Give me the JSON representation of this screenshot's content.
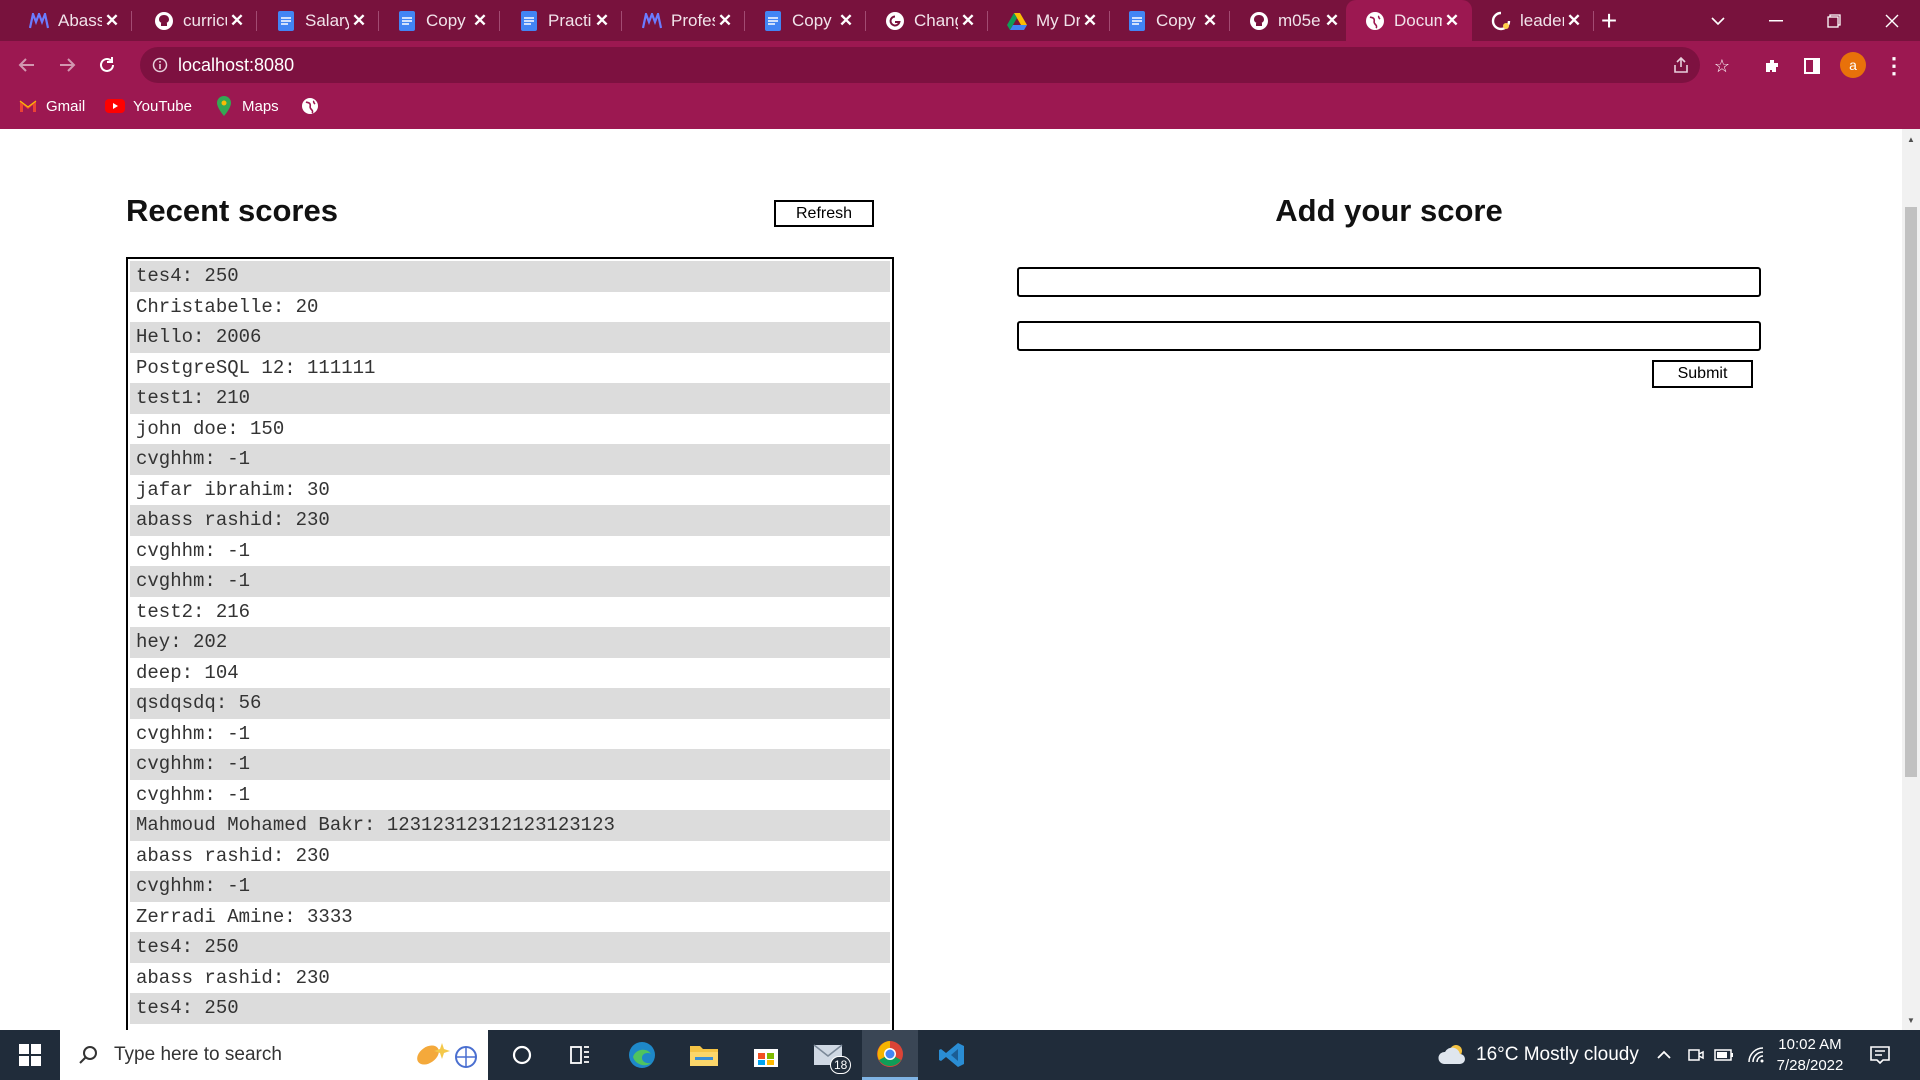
{
  "browser": {
    "tabs": [
      {
        "label": "Abass",
        "icon": "team-logo-icon",
        "active": false
      },
      {
        "label": "curricu",
        "icon": "github-icon",
        "active": false
      },
      {
        "label": "Salary",
        "icon": "docs-icon",
        "active": false
      },
      {
        "label": "Copy o",
        "icon": "docs-icon",
        "active": false
      },
      {
        "label": "Practic",
        "icon": "docs-icon",
        "active": false
      },
      {
        "label": "Profes",
        "icon": "team-logo-icon",
        "active": false
      },
      {
        "label": "Copy o",
        "icon": "docs-icon",
        "active": false
      },
      {
        "label": "Chang",
        "icon": "google-icon",
        "active": false
      },
      {
        "label": "My Dr",
        "icon": "drive-icon",
        "active": false
      },
      {
        "label": "Copy o",
        "icon": "docs-icon",
        "active": false
      },
      {
        "label": "m05e",
        "icon": "github-icon",
        "active": false
      },
      {
        "label": "Docum",
        "icon": "globe-icon",
        "active": true
      },
      {
        "label": "leader",
        "icon": "loading-icon",
        "active": false
      }
    ],
    "url": "localhost:8080",
    "avatar_letter": "a",
    "bookmarks": [
      {
        "label": "Gmail",
        "icon": "gmail-icon"
      },
      {
        "label": "YouTube",
        "icon": "youtube-icon"
      },
      {
        "label": "Maps",
        "icon": "maps-icon"
      }
    ],
    "theme_color": "#9c1851"
  },
  "page": {
    "recent_title": "Recent scores",
    "refresh_label": "Refresh",
    "add_title": "Add your score",
    "submit_label": "Submit",
    "name_input_value": "",
    "score_input_value": "",
    "scores": [
      "tes4: 250",
      "Christabelle: 20",
      "Hello: 2006",
      "PostgreSQL 12: 111111",
      "test1: 210",
      "john doe: 150",
      "cvghhm: -1",
      "jafar ibrahim: 30",
      "abass rashid: 230",
      "cvghhm: -1",
      "cvghhm: -1",
      "test2: 216",
      "hey: 202",
      "deep: 104",
      "qsdqsdq: 56",
      "cvghhm: -1",
      "cvghhm: -1",
      "cvghhm: -1",
      "Mahmoud Mohamed Bakr: 12312312312123123123",
      "abass rashid: 230",
      "cvghhm: -1",
      "Zerradi Amine: 3333",
      "tes4: 250",
      "abass rashid: 230",
      "tes4: 250"
    ]
  },
  "taskbar": {
    "search_placeholder": "Type here to search",
    "mail_badge": "18",
    "weather": "16°C  Mostly cloudy",
    "time": "10:02 AM",
    "date": "7/28/2022"
  }
}
